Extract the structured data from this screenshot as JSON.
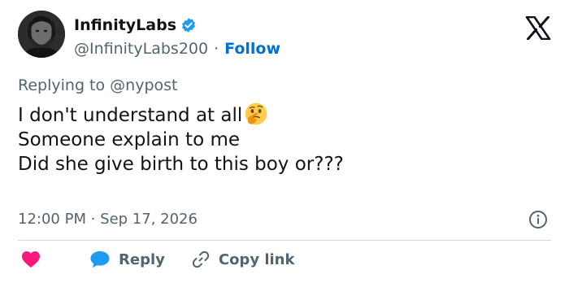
{
  "user": {
    "display_name": "InfinityLabs",
    "handle": "@InfinityLabs200",
    "separator": "·",
    "follow_label": "Follow"
  },
  "replying_to": "Replying to @nypost",
  "tweet": {
    "line1": "I don't understand at all",
    "line2": "Someone explain to me\nDid she give birth to this boy or???"
  },
  "timestamp": "12:00 PM · Sep 17, 2026",
  "actions": {
    "reply_label": "Reply",
    "copy_link_label": "Copy link"
  },
  "colors": {
    "verified": "#1d9bf0",
    "heart": "#f91880",
    "reply_bubble": "#1d9bf0",
    "follow": "#006fd6",
    "secondary_text": "#536471"
  },
  "icons": [
    "verified-badge-icon",
    "x-logo-icon",
    "thinking-face-emoji",
    "info-icon",
    "heart-icon",
    "reply-bubble-icon",
    "link-icon"
  ]
}
